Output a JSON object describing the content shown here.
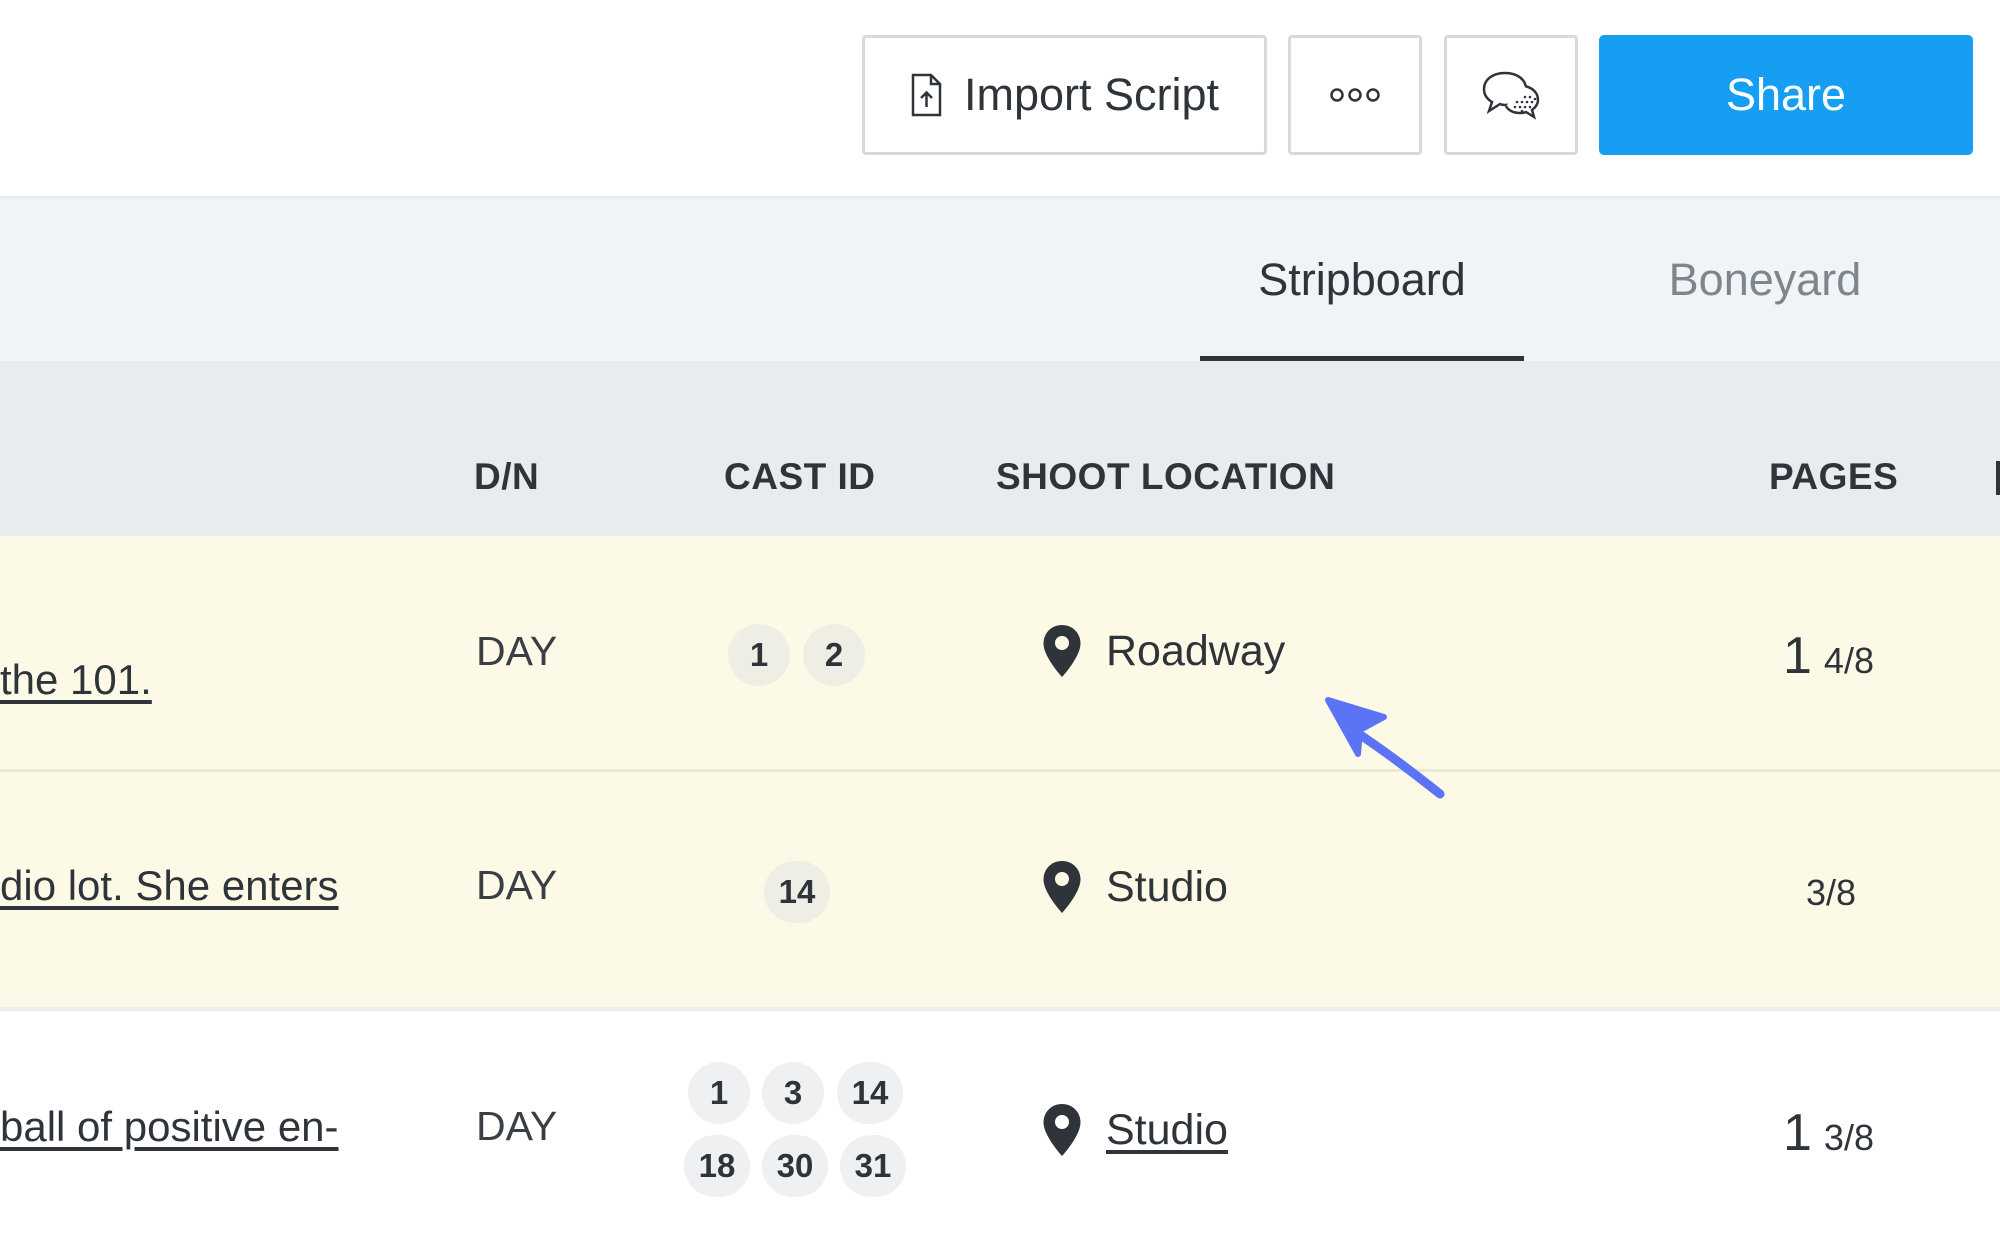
{
  "toolbar": {
    "import_label": "Import Script",
    "more_icon": "more-horizontal-icon",
    "chat_icon": "chat-bubbles-icon",
    "share_label": "Share",
    "share_color": "#159ef2"
  },
  "tabs": [
    {
      "label": "Stripboard",
      "active": true
    },
    {
      "label": "Boneyard",
      "active": false
    }
  ],
  "table": {
    "headers": {
      "dn": "D/N",
      "cast": "CAST ID",
      "location": "SHOOT LOCATION",
      "pages": "PAGES"
    },
    "rows": [
      {
        "description": "the 101.",
        "dn": "DAY",
        "cast": [
          "1",
          "2"
        ],
        "location": "Roadway",
        "location_linked": false,
        "pages_whole": "1",
        "pages_fraction": "4/8",
        "highlighted": true
      },
      {
        "description": "dio lot. She enters",
        "dn": "DAY",
        "cast": [
          "14"
        ],
        "location": "Studio",
        "location_linked": false,
        "pages_whole": "",
        "pages_fraction": "3/8",
        "highlighted": true
      },
      {
        "description": "ball of positive en-",
        "dn": "DAY",
        "cast": [
          "1",
          "3",
          "14",
          "18",
          "30",
          "31"
        ],
        "location": "Studio",
        "location_linked": true,
        "pages_whole": "1",
        "pages_fraction": "3/8",
        "highlighted": false
      }
    ]
  },
  "annotation": {
    "icon": "pointer-arrow-icon",
    "color": "#5b74f6"
  },
  "colors": {
    "row_highlight": "#fcfae6",
    "header_bg": "#e9ecef",
    "tabs_bg": "#f1f4f7"
  }
}
